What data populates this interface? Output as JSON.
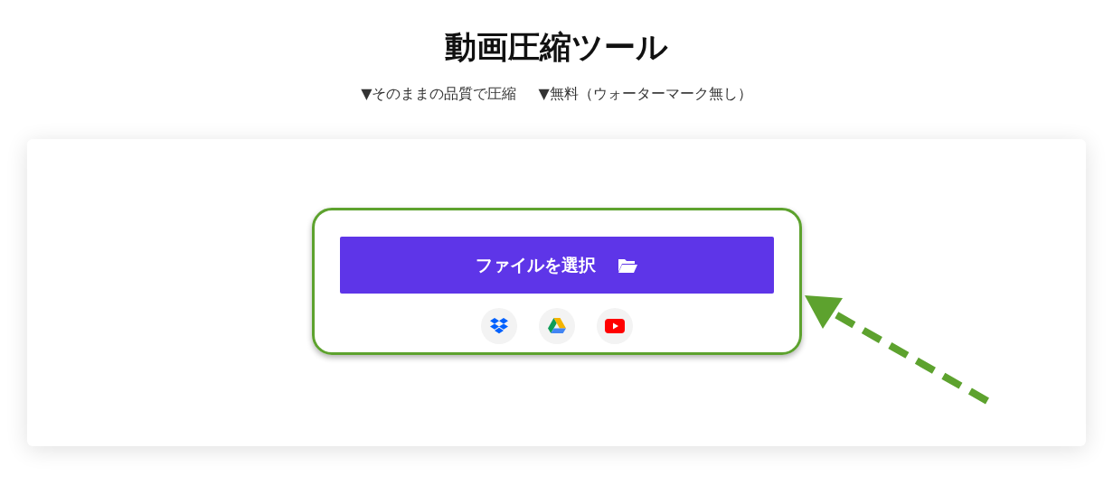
{
  "title": "動画圧縮ツール",
  "features": [
    "▼そのままの品質で圧縮",
    "▼無料（ウォーターマーク無し）"
  ],
  "upload_button": {
    "label": "ファイルを選択"
  }
}
